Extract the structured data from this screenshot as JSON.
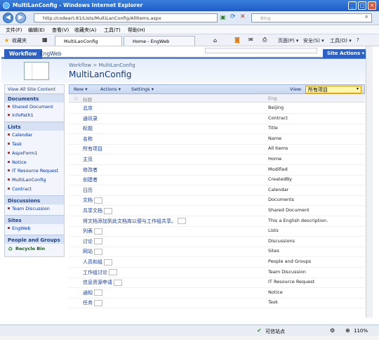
{
  "window": {
    "title": "MultiLanConfig - Windows Internet Explorer"
  },
  "address": {
    "url": "http://codeart:81/Lists/MultiLanConfig/AllItems.aspx",
    "search_placeholder": "Bing"
  },
  "menu": [
    "文件(F)",
    "编辑(E)",
    "查看(V)",
    "收藏夹(A)",
    "工具(T)",
    "帮助(H)"
  ],
  "favorites": {
    "label": "收藏夹",
    "tabs": [
      "MultiLanConfig",
      "Home - EngWeb"
    ],
    "tools": [
      "页面(P) ▾",
      "安全(S) ▾",
      "工具(O) ▾",
      "?"
    ]
  },
  "sharepoint": {
    "tabs": [
      "Workflow",
      "EngWeb"
    ],
    "site_actions": "Site Actions ▾",
    "breadcrumb": "Workflow > MultiLanConfig",
    "page_title": "MultiLanConfig"
  },
  "leftnav": {
    "view_all": "View All Site Content",
    "sections": [
      {
        "title": "Documents",
        "items": [
          "Shared Document",
          "InfoPath1"
        ]
      },
      {
        "title": "Lists",
        "items": [
          "Calendar",
          "Task",
          "AspxForm1",
          "Notice",
          "IT Resource Request",
          "MultiLanConfig",
          "Contract"
        ]
      },
      {
        "title": "Discussions",
        "items": [
          "Team Discussion"
        ]
      },
      {
        "title": "Sites",
        "items": [
          "EngWeb"
        ]
      },
      {
        "title": "People and Groups",
        "items": []
      }
    ],
    "recycle_bin": "Recycle Bin"
  },
  "toolbar": {
    "new": "New ▾",
    "actions": "Actions ▾",
    "settings": "Settings ▾",
    "view_label": "View:",
    "view_value": "所有项目"
  },
  "list": {
    "headers": [
      "标题",
      "Eng"
    ],
    "rows": [
      [
        "北京",
        "Beijing"
      ],
      [
        "通讯录",
        "Contract"
      ],
      [
        "标题",
        "Title"
      ],
      [
        "名称",
        "Name"
      ],
      [
        "所有项目",
        "All Items"
      ],
      [
        "主页",
        "Home"
      ],
      [
        "修改者",
        "Modified"
      ],
      [
        "创建者",
        "CreatedBy"
      ],
      [
        "日历",
        "Calendar"
      ],
      [
        "文档",
        "Documents"
      ],
      [
        "共享文档",
        "Shared Document"
      ],
      [
        "将文档添加到此文档库以便与工作组共享。",
        "This a English description."
      ],
      [
        "列表",
        "Lists"
      ],
      [
        "讨论",
        "Discussions"
      ],
      [
        "网站",
        "Sites"
      ],
      [
        "人员和组",
        "People and Groups"
      ],
      [
        "工作组讨论",
        "Team Discussion"
      ],
      [
        "信息资源申请",
        "IT Resource Request"
      ],
      [
        "通知",
        "Notice"
      ],
      [
        "任务",
        "Task"
      ]
    ]
  },
  "status": {
    "zone": "可信站点",
    "zoom": "110%"
  }
}
